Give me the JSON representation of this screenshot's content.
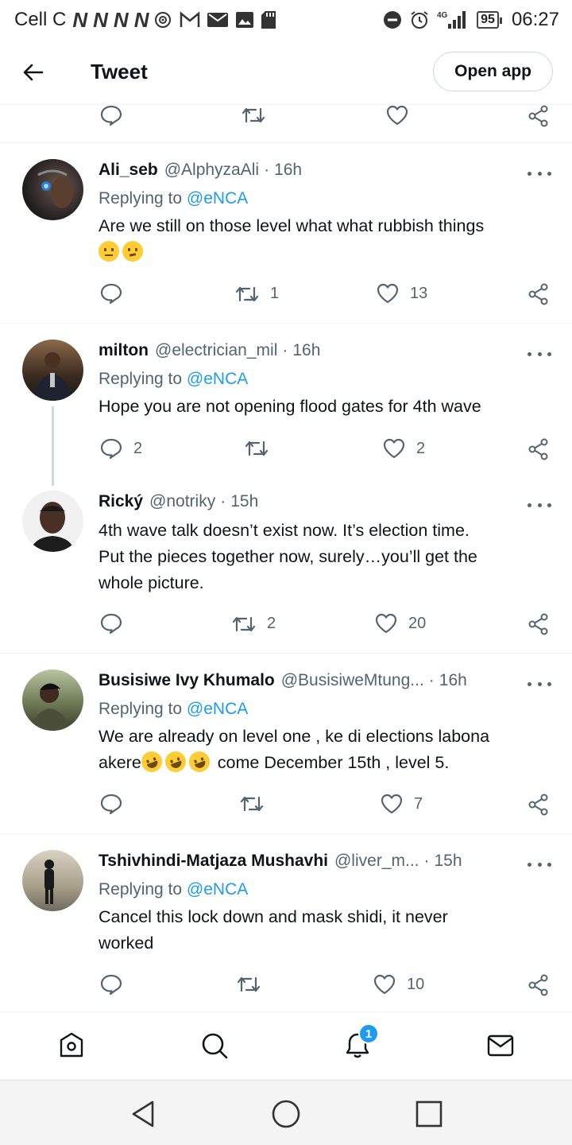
{
  "status_bar": {
    "carrier": "Cell C",
    "network_letters": [
      "N",
      "N",
      "N",
      "N"
    ],
    "icons": [
      "hotspot-icon",
      "gmail-icon",
      "mail-icon",
      "gallery-icon",
      "sd-card-icon",
      "dnd-icon",
      "alarm-icon",
      "signal-4g-icon"
    ],
    "network_type": "4G",
    "battery": "95",
    "time": "06:27"
  },
  "header": {
    "title": "Tweet",
    "open_app_label": "Open app"
  },
  "colors": {
    "accent": "#1d9bf0",
    "secondary_text": "#536471",
    "divider": "#eff3f4"
  },
  "tweets": [
    {
      "name": "Ali_seb",
      "handle": "@AlphyzaAli",
      "time": "16h",
      "replying_prefix": "Replying to",
      "replying_to": "@eNCA",
      "text": "Are we still on those level what what rubbish things",
      "reply_count": "",
      "retweet_count": "1",
      "like_count": "13"
    },
    {
      "name": "milton",
      "handle": "@electrician_mil",
      "time": "16h",
      "replying_prefix": "Replying to",
      "replying_to": "@eNCA",
      "text": "Hope you are not opening flood gates for 4th wave",
      "reply_count": "2",
      "retweet_count": "",
      "like_count": "2"
    },
    {
      "name": "Rický",
      "handle": "@notriky",
      "time": "15h",
      "text_lines": [
        "4th wave talk doesn’t exist now. It’s election time.",
        "Put the pieces together now, surely…you’ll get the",
        "whole picture."
      ],
      "reply_count": "",
      "retweet_count": "2",
      "like_count": "20"
    },
    {
      "name": "Busisiwe Ivy Khumalo",
      "handle": "@BusisiweMtung...",
      "time": "16h",
      "replying_prefix": "Replying to",
      "replying_to": "@eNCA",
      "text_line1": "We are already on level one , ke di elections labona",
      "text_line2_start": "akere",
      "text_line2_end": " come December 15th , level 5.",
      "reply_count": "",
      "retweet_count": "",
      "like_count": "7"
    },
    {
      "name": "Tshivhindi-Matjaza Mushavhi",
      "handle": "@liver_m...",
      "time": "15h",
      "replying_prefix": "Replying to",
      "replying_to": "@eNCA",
      "text_lines": [
        "Cancel this lock down and mask shidi, it never",
        "worked"
      ],
      "reply_count": "",
      "retweet_count": "",
      "like_count": "10"
    }
  ],
  "bottom_nav": {
    "items": [
      "home-icon",
      "search-icon",
      "notifications-icon",
      "messages-icon"
    ],
    "notification_badge": "1"
  },
  "system_nav": [
    "back-triangle-icon",
    "home-circle-icon",
    "recents-square-icon"
  ]
}
